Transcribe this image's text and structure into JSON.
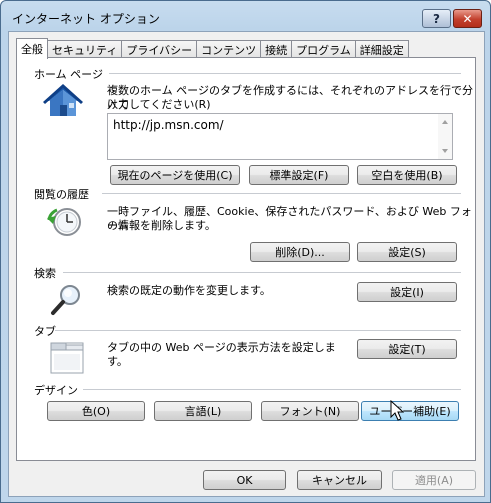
{
  "window": {
    "title": "インターネット オプション",
    "help_label": "?",
    "close_label": "✕"
  },
  "tabs": [
    {
      "label": "全般",
      "active": true
    },
    {
      "label": "セキュリティ",
      "active": false
    },
    {
      "label": "プライバシー",
      "active": false
    },
    {
      "label": "コンテンツ",
      "active": false
    },
    {
      "label": "接続",
      "active": false
    },
    {
      "label": "プログラム",
      "active": false
    },
    {
      "label": "詳細設定",
      "active": false
    }
  ],
  "home": {
    "heading": "ホーム ページ",
    "desc_line1": "複数のホーム ページのタブを作成するには、それぞれのアドレスを行で分けて",
    "desc_line2": "入力してください(R)",
    "url": "http://jp.msn.com/",
    "btn_current": "現在のページを使用(C)",
    "btn_default": "標準設定(F)",
    "btn_blank": "空白を使用(B)"
  },
  "history": {
    "heading": "閲覧の履歴",
    "desc_line1": "一時ファイル、履歴、Cookie、保存されたパスワード、および Web フォーム",
    "desc_line2": "の情報を削除します。",
    "btn_delete": "削除(D)...",
    "btn_settings": "設定(S)"
  },
  "search": {
    "heading": "検索",
    "desc": "検索の既定の動作を変更します。",
    "btn_settings": "設定(I)"
  },
  "tabsection": {
    "heading": "タブ",
    "desc_line1": "タブの中の Web ページの表示方法を設定しま",
    "desc_line2": "す。",
    "btn_settings": "設定(T)"
  },
  "design": {
    "heading": "デザイン",
    "btn_colors": "色(O)",
    "btn_languages": "言語(L)",
    "btn_fonts": "フォント(N)",
    "btn_accessibility": "ユーザー補助(E)"
  },
  "footer": {
    "ok": "OK",
    "cancel": "キャンセル",
    "apply": "適用(A)"
  },
  "colors": {
    "accent": "#3c7fb1",
    "title_bg": "#c7dcef",
    "close_red": "#c2402d"
  }
}
